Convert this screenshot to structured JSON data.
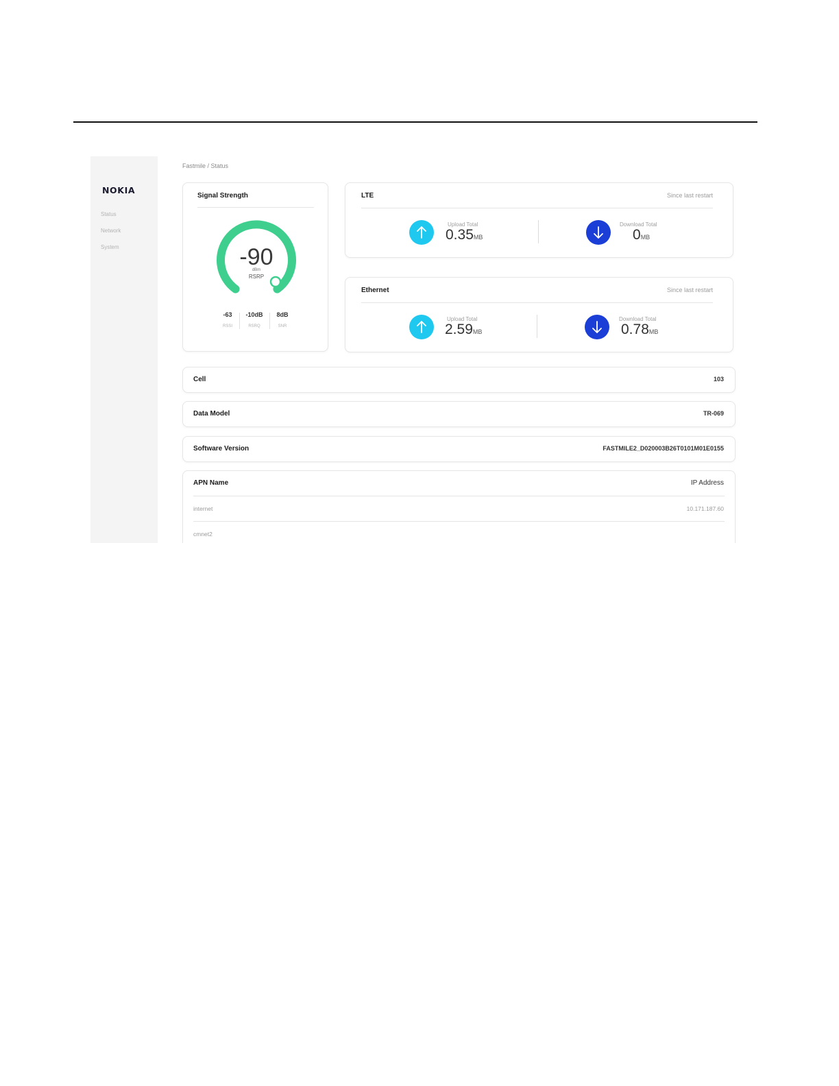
{
  "brand": "NOKIA",
  "sidebar": {
    "items": [
      {
        "label": "Status"
      },
      {
        "label": "Network"
      },
      {
        "label": "System"
      }
    ]
  },
  "breadcrumb": "Fastmile / Status",
  "signal": {
    "title": "Signal Strength",
    "rsrp_value": "-90",
    "rsrp_unit": "dBm",
    "rsrp_label": "RSRP",
    "metrics": [
      {
        "value": "-63",
        "label": "RSSI"
      },
      {
        "value": "-10dB",
        "label": "RSRQ"
      },
      {
        "value": "8dB",
        "label": "SNR"
      }
    ],
    "gauge_color": "#3ecf8e"
  },
  "lte": {
    "title": "LTE",
    "since": "Since last restart",
    "upload": {
      "label": "Upload Total",
      "value": "0.35",
      "unit": "MB"
    },
    "download": {
      "label": "Download Total",
      "value": "0",
      "unit": "MB"
    }
  },
  "ethernet": {
    "title": "Ethernet",
    "since": "Since last restart",
    "upload": {
      "label": "Upload Total",
      "value": "2.59",
      "unit": "MB"
    },
    "download": {
      "label": "Download Total",
      "value": "0.78",
      "unit": "MB"
    }
  },
  "info": {
    "cell": {
      "label": "Cell",
      "value": "103"
    },
    "data_model": {
      "label": "Data Model",
      "value": "TR-069"
    },
    "software": {
      "label": "Software Version",
      "value": "FASTMILE2_D020003B26T0101M01E0155"
    }
  },
  "apn": {
    "col_name": "APN Name",
    "col_ip": "IP Address",
    "rows": [
      {
        "name": "internet",
        "ip": "10.171.187.60"
      },
      {
        "name": "cmnet2",
        "ip": ""
      }
    ]
  },
  "colors": {
    "upload_circle": "#1ec8ef",
    "download_circle": "#1a3ed6"
  }
}
